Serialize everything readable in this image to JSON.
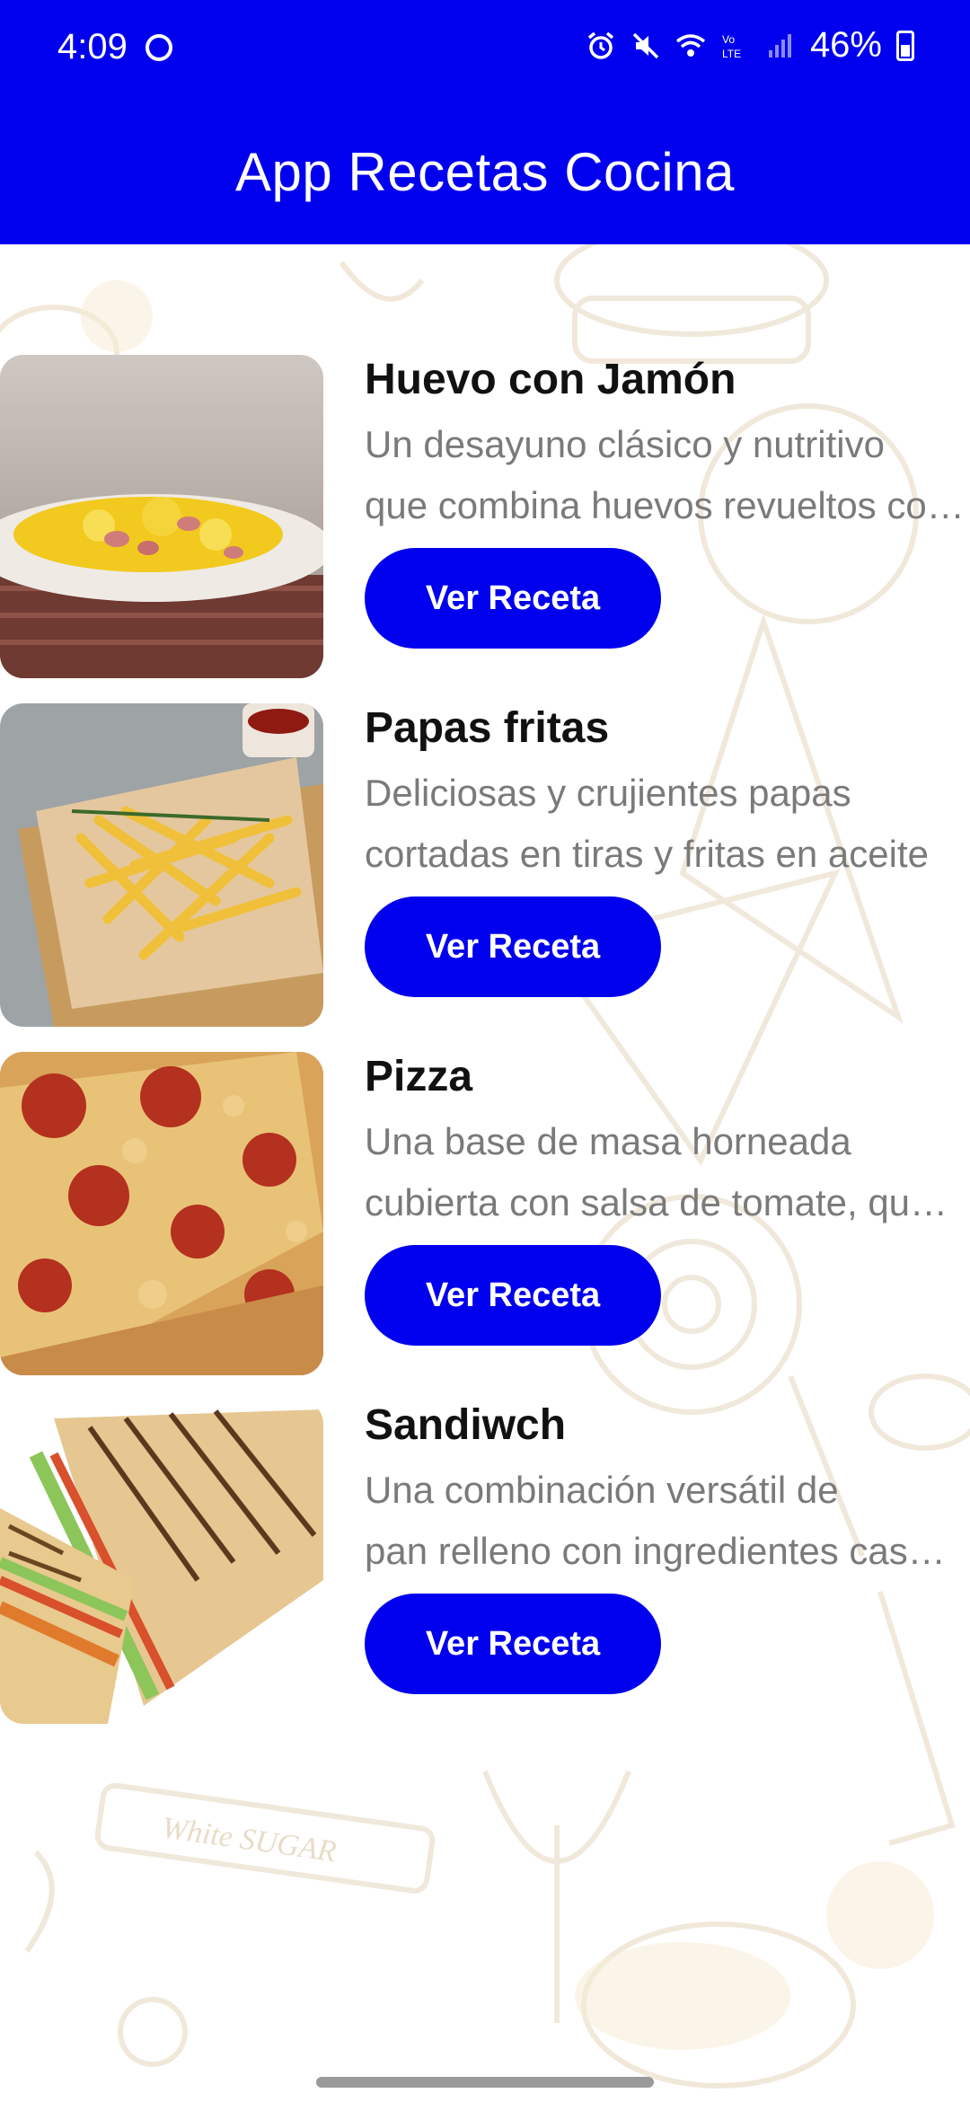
{
  "status_bar": {
    "time": "4:09",
    "battery": "46%",
    "icons": [
      "face-icon",
      "alarm-icon",
      "mute-icon",
      "wifi-icon",
      "volte-icon",
      "signal-icon",
      "battery-icon"
    ]
  },
  "app_bar": {
    "title": "App Recetas Cocina"
  },
  "colors": {
    "primary": "#0000ee",
    "title_text": "#111111",
    "desc_text": "#7a7a7a"
  },
  "recipes": [
    {
      "title": "Huevo con Jamón",
      "desc_line1": "Un desayuno clásico y nutritivo",
      "desc_line2": "que combina huevos revueltos con jamón",
      "button": "Ver Receta",
      "image_icon": "scrambled-eggs-ham-photo"
    },
    {
      "title": "Papas fritas",
      "desc_line1": "Deliciosas y crujientes papas",
      "desc_line2": "cortadas en tiras y fritas en aceite",
      "button": "Ver Receta",
      "image_icon": "french-fries-photo"
    },
    {
      "title": "Pizza",
      "desc_line1": "Una base de masa horneada",
      "desc_line2": "cubierta con salsa de tomate, queso",
      "button": "Ver Receta",
      "image_icon": "pizza-photo"
    },
    {
      "title": "Sandiwch",
      "desc_line1": "Una combinación versátil de",
      "desc_line2": "pan relleno con ingredientes caseros",
      "button": "Ver Receta",
      "image_icon": "sandwich-photo"
    }
  ]
}
